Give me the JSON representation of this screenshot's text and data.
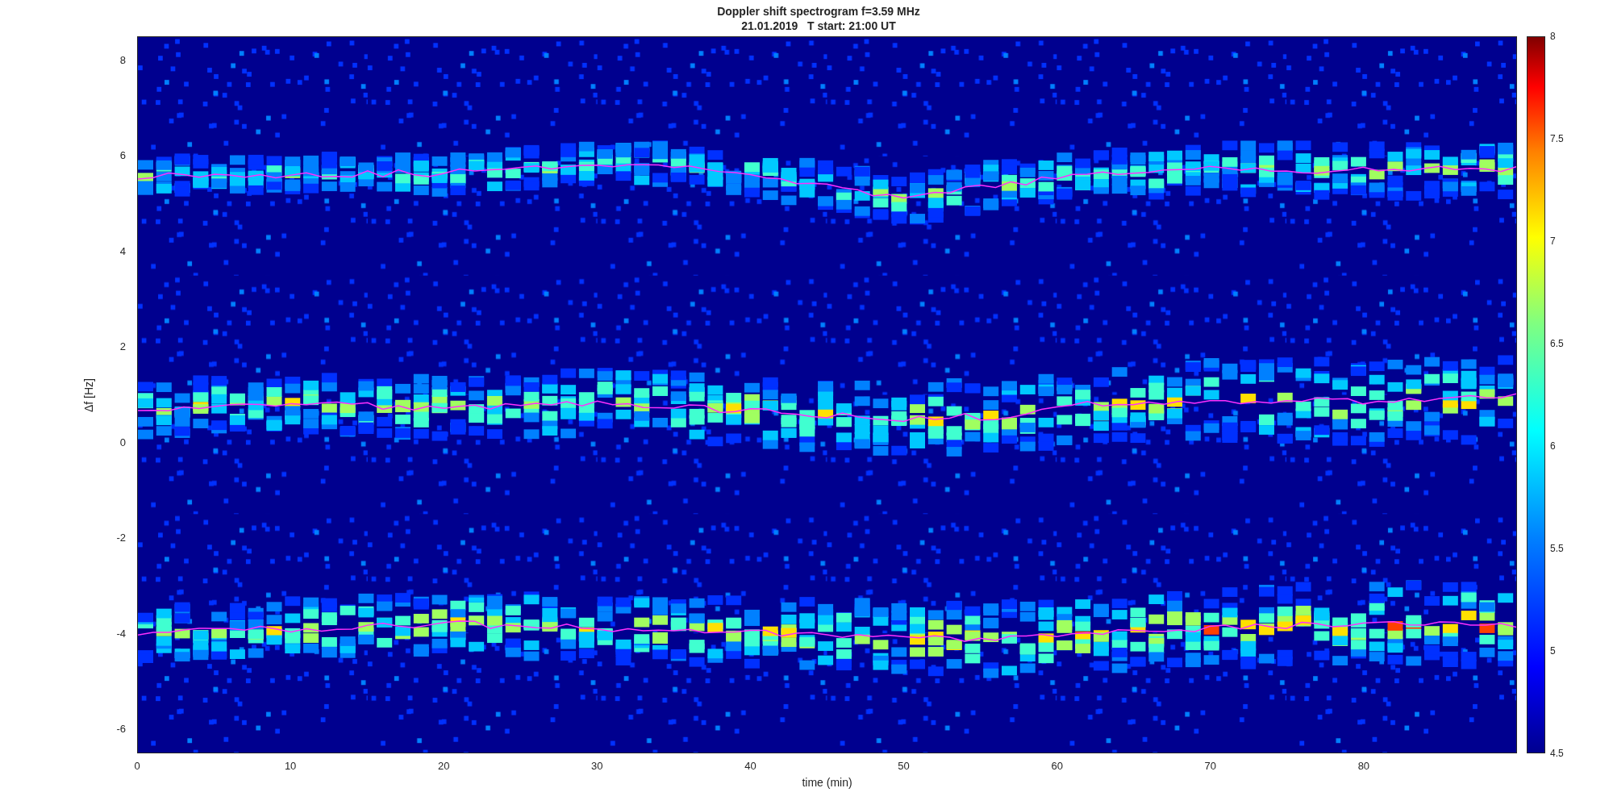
{
  "figure": {
    "title": "Doppler shift spectrogram f=3.59 MHz",
    "subtitle": "21.01.2019   T start: 21:00 UT"
  },
  "axes": {
    "xlabel": "time (min)",
    "ylabel": "Δf [Hz]",
    "xticks": [
      "0",
      "10",
      "20",
      "30",
      "40",
      "50",
      "60",
      "70",
      "80"
    ],
    "yticks": [
      "8",
      "6",
      "4",
      "2",
      "0",
      "-2",
      "-4",
      "-6"
    ]
  },
  "colorbar": {
    "ticks": [
      "8",
      "7.5",
      "7",
      "6.5",
      "6",
      "5.5",
      "5",
      "4.5"
    ]
  }
}
